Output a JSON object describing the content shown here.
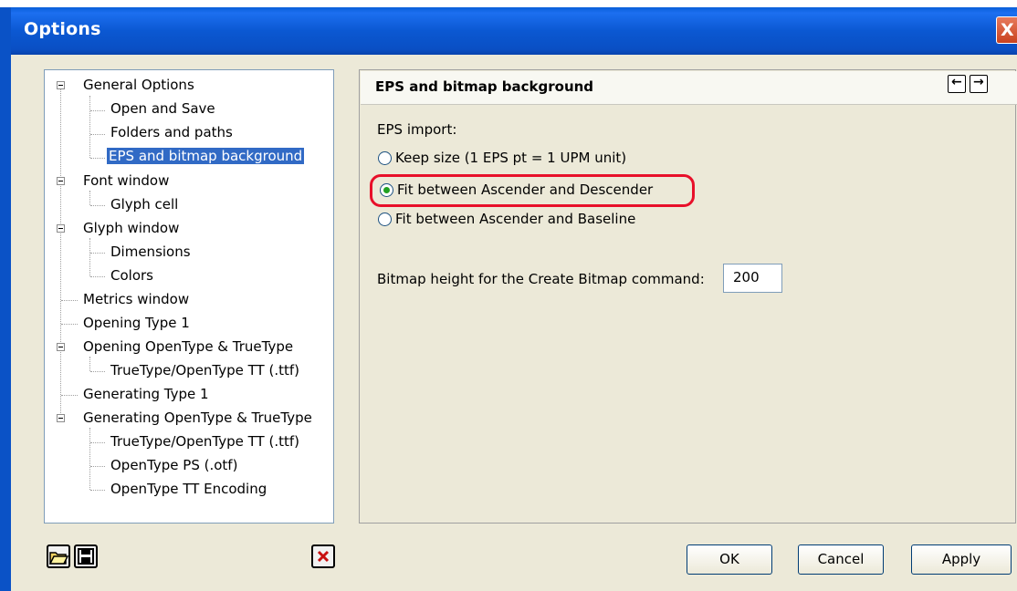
{
  "window": {
    "title": "Options",
    "close_glyph": "X"
  },
  "tree": {
    "items": [
      {
        "label": "General Options",
        "level": 0,
        "expanded": true
      },
      {
        "label": "Open and Save",
        "level": 1
      },
      {
        "label": "Folders and paths",
        "level": 1
      },
      {
        "label": "EPS and bitmap background",
        "level": 1,
        "selected": true
      },
      {
        "label": "Font window",
        "level": 0,
        "expanded": true
      },
      {
        "label": "Glyph cell",
        "level": 1
      },
      {
        "label": "Glyph window",
        "level": 0,
        "expanded": true
      },
      {
        "label": "Dimensions",
        "level": 1
      },
      {
        "label": "Colors",
        "level": 1
      },
      {
        "label": "Metrics window",
        "level": 0
      },
      {
        "label": "Opening Type 1",
        "level": 0
      },
      {
        "label": "Opening OpenType & TrueType",
        "level": 0,
        "expanded": true
      },
      {
        "label": "TrueType/OpenType TT (.ttf)",
        "level": 1
      },
      {
        "label": "Generating Type 1",
        "level": 0
      },
      {
        "label": "Generating OpenType & TrueType",
        "level": 0,
        "expanded": true
      },
      {
        "label": "TrueType/OpenType TT (.ttf)",
        "level": 1
      },
      {
        "label": "OpenType PS (.otf)",
        "level": 1
      },
      {
        "label": "OpenType TT Encoding",
        "level": 1
      }
    ]
  },
  "panel": {
    "title": "EPS and bitmap background",
    "back_glyph": "🡐",
    "forward_glyph": "🡒",
    "eps_import_label": "EPS import:",
    "options": [
      {
        "label": "Keep size (1 EPS pt = 1 UPM unit)",
        "selected": false
      },
      {
        "label": "Fit between Ascender and Descender",
        "selected": true
      },
      {
        "label": "Fit between Ascender and Baseline",
        "selected": false
      }
    ],
    "bitmap_label": "Bitmap height for the Create Bitmap command:",
    "bitmap_value": "200"
  },
  "buttons": {
    "ok": "OK",
    "cancel": "Cancel",
    "apply": "Apply"
  },
  "icons": {
    "open": "folder-open-icon",
    "save": "floppy-save-icon",
    "delete": "delete-x-icon"
  },
  "colors": {
    "titlebar": "#0a5fd8",
    "selection": "#316ac5",
    "highlight_ring": "#e8102a",
    "radio_on": "#21a121"
  }
}
